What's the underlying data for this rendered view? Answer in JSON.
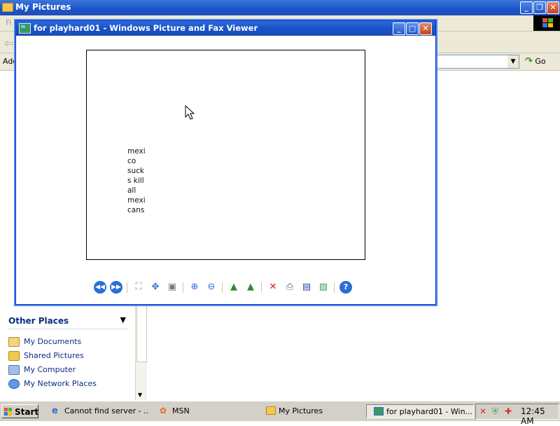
{
  "explorer": {
    "title": "My Pictures",
    "menu_first": "Fi",
    "address_label": "Addr",
    "go_label": "Go",
    "other_places": {
      "header": "Other Places",
      "items": [
        {
          "label": "My Documents",
          "icon": "my-documents-icon"
        },
        {
          "label": "Shared Pictures",
          "icon": "shared-pictures-icon"
        },
        {
          "label": "My Computer",
          "icon": "my-computer-icon"
        },
        {
          "label": "My Network Places",
          "icon": "network-places-icon"
        }
      ]
    }
  },
  "viewer": {
    "title": "for playhard01 - Windows Picture and Fax Viewer",
    "image_lines": [
      "mexi",
      "co",
      "suck",
      "s kill",
      "all",
      "mexi",
      "cans"
    ],
    "toolbar": [
      {
        "name": "previous-image",
        "icon": "previous-icon"
      },
      {
        "name": "next-image",
        "icon": "next-icon"
      },
      {
        "name": "best-fit",
        "icon": "best-fit-icon"
      },
      {
        "name": "actual-size",
        "icon": "actual-size-icon"
      },
      {
        "name": "slideshow",
        "icon": "slideshow-icon"
      },
      {
        "name": "zoom-in",
        "icon": "zoom-in-icon"
      },
      {
        "name": "zoom-out",
        "icon": "zoom-out-icon"
      },
      {
        "name": "rotate-clockwise",
        "icon": "rotate-clockwise-icon"
      },
      {
        "name": "rotate-counterclockwise",
        "icon": "rotate-counterclockwise-icon"
      },
      {
        "name": "delete",
        "icon": "delete-icon"
      },
      {
        "name": "print",
        "icon": "print-icon"
      },
      {
        "name": "save",
        "icon": "save-icon"
      },
      {
        "name": "edit",
        "icon": "edit-icon"
      },
      {
        "name": "help",
        "icon": "help-icon"
      }
    ]
  },
  "taskbar": {
    "start_label": "Start",
    "tasks": [
      {
        "label": "Cannot find server - ...",
        "icon": "internet-explorer-icon"
      },
      {
        "label": "MSN",
        "icon": "msn-icon"
      },
      {
        "label": "My Pictures",
        "icon": "folder-icon"
      },
      {
        "label": "for playhard01 - Win...",
        "icon": "picture-viewer-icon",
        "active": true
      }
    ],
    "clock": "12:45 AM"
  },
  "colors": {
    "titlebar_blue": "#1c54c7",
    "link_blue": "#0c2d82",
    "taskbar_gray": "#d4d0c8"
  }
}
